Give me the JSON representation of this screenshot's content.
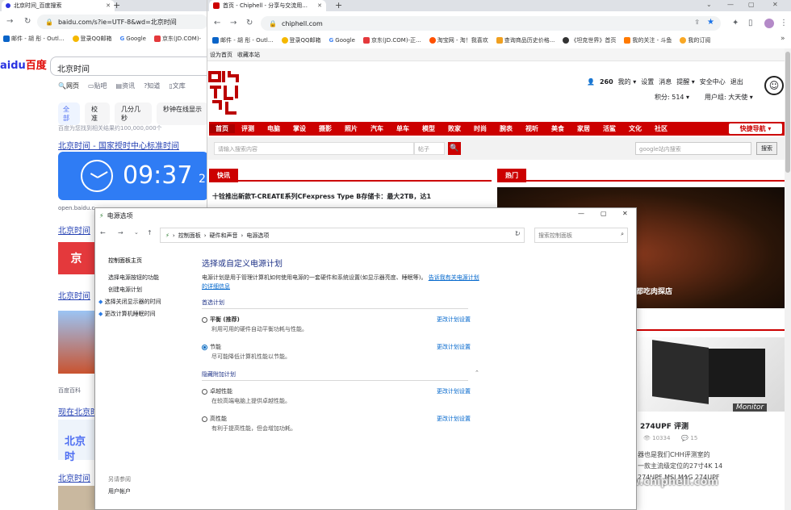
{
  "baidu": {
    "tab_title": "北京时间_百度搜索",
    "url": "baidu.com/s?ie=UTF-8&wd=北京时间",
    "bookmarks": [
      "邮件 - 胡 彤 - Outl...",
      "登录QQ邮箱",
      "Google",
      "京东(JD.COM)-"
    ],
    "logo": "百度",
    "query": "北京时间",
    "tabs": [
      "网页",
      "贴吧",
      "资讯",
      "知道",
      "文库"
    ],
    "filters": [
      "全部",
      "校准",
      "几分几秒",
      "秒钟在线显示"
    ],
    "result_count": "百度为您找到相关结果约100,000,000个",
    "result1_title": "北京时间 - 国家授时中心标准时间",
    "clock_time": "09:37",
    "clock_suffix": "2",
    "result1_url": "open.baidu.c...",
    "result2_title": "北京时间",
    "result3_title": "北京时间",
    "snippet_label": "百度百科",
    "result4_title": "现在北京时间",
    "result4_box": "北京时",
    "result5_title": "北京时间"
  },
  "chiphell": {
    "tab_title": "首页 - Chiphell - 分享与交流用...",
    "url": "chiphell.com",
    "bookmarks": [
      "邮件 - 胡 彤 - Outl...",
      "登录QQ邮箱",
      "Google",
      "京东(JD.COM)-正...",
      "淘宝网 - 淘！我喜欢",
      "查询商品历史价格...",
      "《坦克世界》首页",
      "我的关注 - 斗鱼",
      "我的订阅"
    ],
    "topbar": [
      "设为首页",
      "收藏本站"
    ],
    "user": {
      "points": "260",
      "menu": [
        "我的 ▾",
        "设置",
        "消息",
        "提醒 ▾",
        "安全中心",
        "退出"
      ],
      "score": "积分: 514 ▾",
      "group": "用户组: 大天使 ▾"
    },
    "nav": [
      "首页",
      "评测",
      "电脑",
      "掌设",
      "摄影",
      "照片",
      "汽车",
      "单车",
      "模型",
      "败家",
      "时尚",
      "腕表",
      "视听",
      "美食",
      "家居",
      "活鲨",
      "文化",
      "社区"
    ],
    "quick_nav": "快捷导航 ▾",
    "search_placeholder": "请输入搜索内容",
    "search_type": "帖子",
    "google_placeholder": "google站内搜索",
    "google_button": "搜索",
    "news_tab": "快讯",
    "hot_tab": "热门",
    "headline": "十铨推出新款T-CREATE系列CFexpress Type B存储卡：最大2TB，达1",
    "food_caption": "都吃肉探店",
    "monitor_brand": "Monitor",
    "review_title": "274UPF 评测",
    "stats": [
      "10334",
      "15"
    ],
    "review_text": [
      "器也是我们CHH评测室的",
      "一款主流级定位的27寸4K 14",
      "274UPF MSI MAG 274UPF"
    ],
    "watermark": "www.chiphell.com"
  },
  "power": {
    "title": "电源选项",
    "breadcrumb": [
      "控制面板",
      "硬件和声音",
      "电源选项"
    ],
    "search_placeholder": "搜索控制面板",
    "sidebar": [
      "控制面板主页",
      "选择电源按钮的功能",
      "创建电源计划",
      "选择关闭显示器的时间",
      "更改计算机睡眠时间"
    ],
    "see_also": "另请参阅",
    "user_account": "用户帐户",
    "heading": "选择或自定义电源计划",
    "desc": "电源计划是用于管理计算机如何使用电源的一套硬件和系统设置(如显示器亮度、睡眠等)。",
    "desc_link": "告诉我有关电源计划的详细信息",
    "preferred": "首选计划",
    "hidden": "隐藏附加计划",
    "plans": [
      {
        "name": "平衡 (推荐)",
        "desc": "利用可用的硬件自动平衡功耗与性能。",
        "link": "更改计划设置",
        "selected": false
      },
      {
        "name": "节能",
        "desc": "尽可能降低计算机性能以节能。",
        "link": "更改计划设置",
        "selected": true
      },
      {
        "name": "卓越性能",
        "desc": "在较高端电脑上提供卓越性能。",
        "link": "更改计划设置",
        "selected": false
      },
      {
        "name": "高性能",
        "desc": "有利于提高性能，但会增加功耗。",
        "link": "更改计划设置",
        "selected": false
      }
    ]
  }
}
